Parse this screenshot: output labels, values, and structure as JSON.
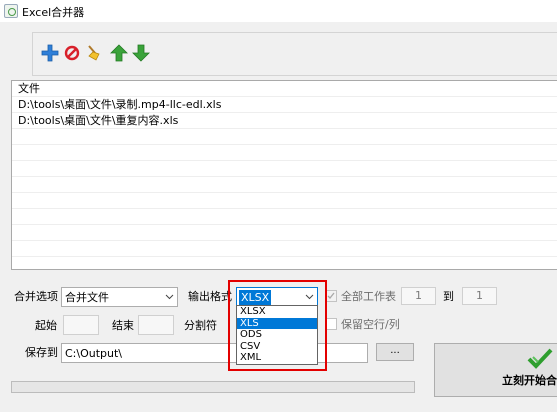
{
  "window": {
    "title": "Excel合并器"
  },
  "toolbar": {
    "tools": [
      {
        "icon": "add-icon"
      },
      {
        "icon": "remove-icon"
      },
      {
        "icon": "clear-broom-icon"
      },
      {
        "icon": "move-up-icon"
      },
      {
        "icon": "move-down-icon"
      }
    ]
  },
  "filelist": {
    "header": "文件",
    "files": [
      "D:\\tools\\桌面\\文件\\录制.mp4-llc-edl.xls",
      "D:\\tools\\桌面\\文件\\重复内容.xls"
    ]
  },
  "options": {
    "merge_label": "合并选项",
    "merge_value": "合并文件",
    "format_label": "输出格式",
    "format_value": "XLSX",
    "format_options": [
      "XLSX",
      "XLS",
      "ODS",
      "CSV",
      "XML"
    ],
    "format_selected_index": 1,
    "all_sheets_label": "全部工作表",
    "sheet_from": "1",
    "to_label": "到",
    "sheet_to": "1",
    "start_label": "起始",
    "end_label": "结束",
    "separator_label": "分割符",
    "keep_empty_label": "保留空行/列",
    "save_label": "保存到",
    "save_path": "C:\\Output\\",
    "browse_label": "...",
    "start_button_label": "立刻开始合"
  },
  "colors": {
    "highlight": "#0078d7",
    "callout": "#e30000",
    "green": "#2e9e2e"
  }
}
